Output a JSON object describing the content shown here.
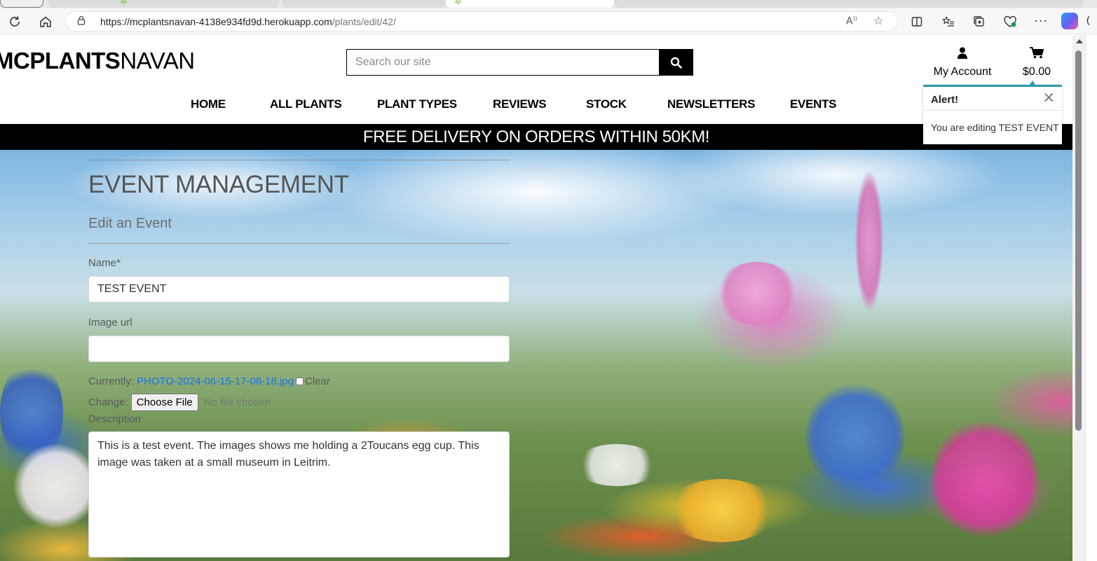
{
  "browser": {
    "url_host": "https://mcplantsnavan-4138e934fd9d.herokuapp.com",
    "url_path": "/plants/edit/42/",
    "icons": [
      "refresh-icon",
      "home-icon",
      "lock-icon",
      "read-aloud-icon",
      "favorite-star-icon",
      "split-screen-icon",
      "favorites-icon",
      "collections-icon",
      "browser-essentials-icon",
      "more-icon",
      "copilot-icon"
    ]
  },
  "header": {
    "logo_bold": "MCPLANTS",
    "logo_light": "NAVAN",
    "search_placeholder": "Search our site",
    "account_label": "My Account",
    "cart_total": "$0.00"
  },
  "nav": {
    "items": [
      "HOME",
      "ALL PLANTS",
      "PLANT TYPES",
      "REVIEWS",
      "STOCK",
      "NEWSLETTERS",
      "EVENTS"
    ]
  },
  "banner": {
    "text": "FREE DELIVERY ON ORDERS WITHIN 50KM!"
  },
  "form": {
    "title": "EVENT MANAGEMENT",
    "subtitle": "Edit an Event",
    "name_label": "Name*",
    "name_value": "TEST EVENT",
    "image_url_label": "Image url",
    "image_url_value": "",
    "currently_label": "Currently:",
    "current_file": "PHOTO-2024-06-15-17-08-18.jpg",
    "clear_label": "Clear",
    "change_label": "Change:",
    "choose_file_label": "Choose File",
    "no_file_label": "No file chosen",
    "description_label": "Description",
    "description_value": "This is a test event. The images shows me holding a 2Toucans egg cup. This image was taken at a small museum in Leitrim."
  },
  "toast": {
    "title": "Alert!",
    "message": "You are editing TEST EVENT"
  },
  "colors": {
    "accent": "#2f9aa7",
    "banner_bg": "#000000",
    "link": "#1a73e8"
  }
}
